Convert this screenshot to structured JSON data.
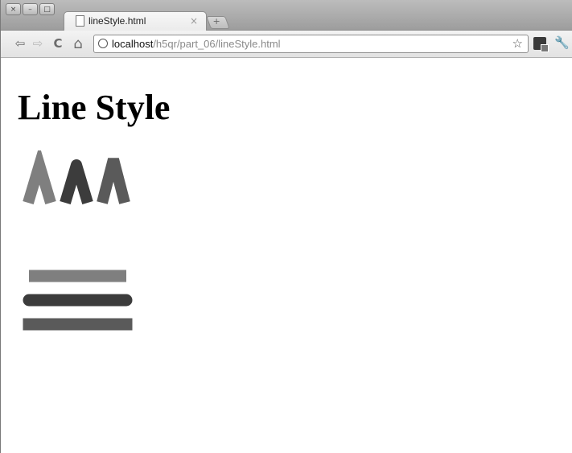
{
  "window": {
    "controls": [
      "×",
      "–",
      "□"
    ]
  },
  "tab": {
    "title": "lineStyle.html",
    "close": "×",
    "icon": "page-icon"
  },
  "new_tab_symbol": "+",
  "toolbar": {
    "back": "⇦",
    "forward": "⇨",
    "reload": "C",
    "home": "⌂",
    "url_host": "localhost",
    "url_path": "/h5qr/part_06/lineStyle.html",
    "star": "☆",
    "wrench": "🔧"
  },
  "page": {
    "heading": "Line Style"
  },
  "colors": {
    "stroke_light": "#7f7f7f",
    "stroke_dark": "#3c3c3c",
    "stroke_mid": "#5a5a5a"
  }
}
